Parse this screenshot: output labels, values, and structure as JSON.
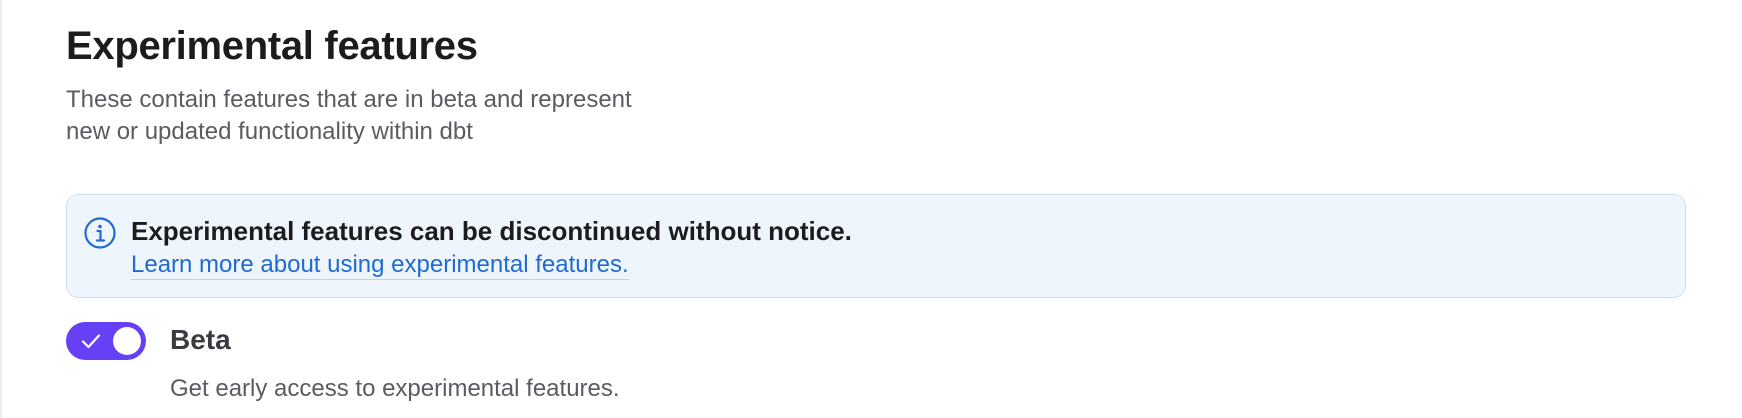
{
  "section": {
    "title": "Experimental features",
    "description_line1": "These contain features that are in beta and represent",
    "description_line2": "new or updated functionality within dbt"
  },
  "callout": {
    "icon": "info-icon",
    "heading": "Experimental features can be discontinued without notice.",
    "link_text": "Learn more about using experimental features."
  },
  "beta_toggle": {
    "label": "Beta",
    "description": "Get early access to experimental features.",
    "checked": true,
    "icon": "check-icon"
  },
  "colors": {
    "toggle_on": "#6540f5",
    "link": "#1f6bd1",
    "callout_bg": "#eff5fc",
    "callout_border": "#cfdff3"
  }
}
